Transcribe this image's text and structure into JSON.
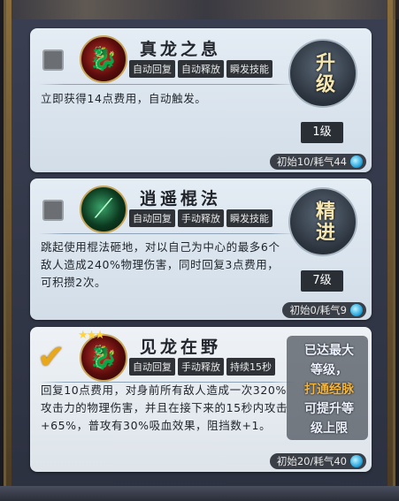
{
  "skills": [
    {
      "name": "真龙之息",
      "tags": [
        "自动回复",
        "自动释放",
        "瞬发技能"
      ],
      "description": "立即获得14点费用，自动触发。",
      "action_label": "升级",
      "level": "1级",
      "cost": "初始10/耗气44",
      "checked": false,
      "icon": "dragon-icon"
    },
    {
      "name": "逍遥棍法",
      "tags": [
        "自动回复",
        "手动释放",
        "瞬发技能"
      ],
      "description": "跳起使用棍法砸地，对以自己为中心的最多6个敌人造成240%物理伤害，同时回复3点费用，可积攒2次。",
      "action_label": "精进",
      "level": "7级",
      "cost": "初始0/耗气9",
      "checked": false,
      "icon": "staff-icon"
    },
    {
      "name": "见龙在野",
      "tags": [
        "自动回复",
        "手动释放",
        "持续15秒"
      ],
      "description": "回复10点费用，对身前所有敌人造成一次320%攻击力的物理伤害，并且在接下来的15秒内攻击+65%，普攻有30%吸血效果，阻挡数+1。",
      "maxed_lines": [
        "已达最大",
        "等级，",
        "打通经脉",
        "可提升等",
        "级上限"
      ],
      "cost": "初始20/耗气40",
      "checked": true,
      "icon": "dragon-icon"
    }
  ],
  "colors": {
    "accent_gold": "#f5b43a",
    "card_bg": "#e4ecf4",
    "tag_bg": "#2f3338"
  }
}
